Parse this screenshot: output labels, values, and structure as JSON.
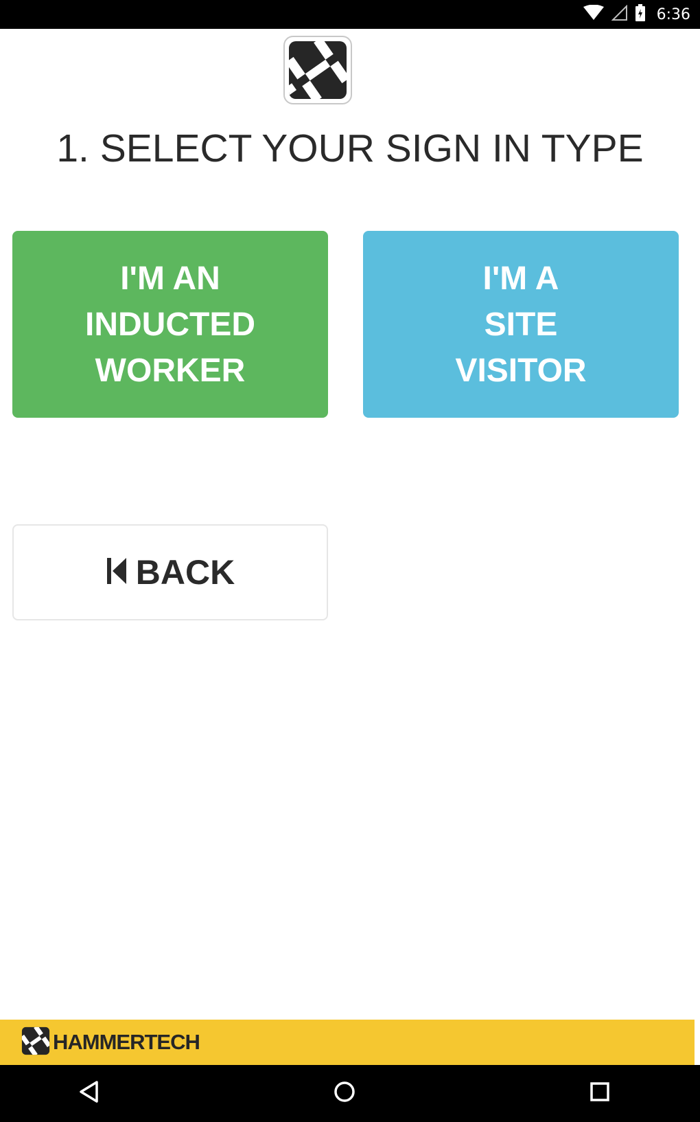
{
  "status_bar": {
    "time": "6:36",
    "icons": [
      "wifi-icon",
      "cell-signal-icon",
      "battery-icon"
    ]
  },
  "header": {
    "logo_icon": "hammertech-logo-icon",
    "title": "1. SELECT YOUR SIGN IN TYPE"
  },
  "options": {
    "worker": {
      "lines": [
        "I'M AN",
        "INDUCTED",
        "WORKER"
      ],
      "color": "#5db75e"
    },
    "visitor": {
      "lines": [
        "I'M A",
        "SITE",
        "VISITOR"
      ],
      "color": "#5bbedd"
    }
  },
  "back_button": {
    "label": "BACK",
    "icon": "skip-back-icon"
  },
  "footer": {
    "brand": "HAMMERTECH",
    "color": "#f5c730"
  },
  "nav_bar": {
    "buttons": [
      "back-triangle-icon",
      "home-circle-icon",
      "recents-square-icon"
    ]
  }
}
